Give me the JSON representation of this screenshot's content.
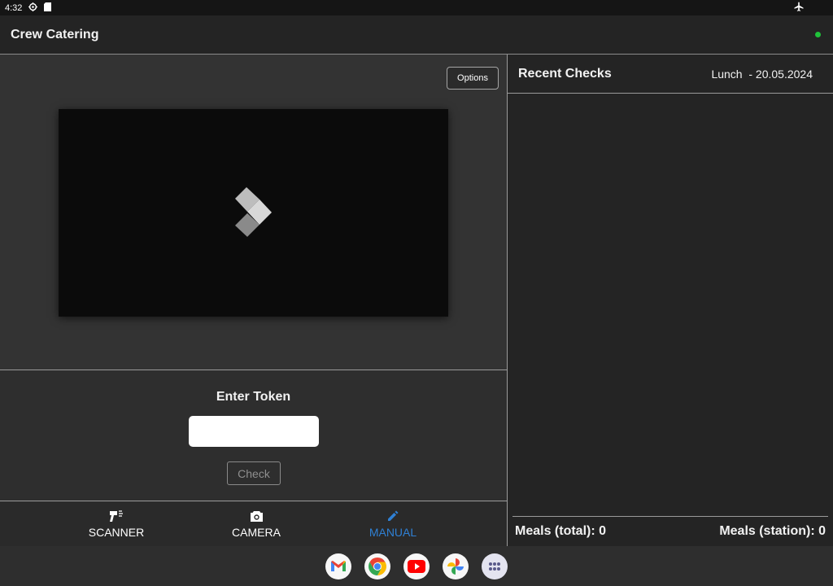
{
  "status_bar": {
    "time": "4:32"
  },
  "app": {
    "title": "Crew Catering",
    "status_color": "#1fc23a"
  },
  "camera": {
    "options_label": "Options"
  },
  "token": {
    "title": "Enter Token",
    "input_value": "",
    "check_label": "Check"
  },
  "nav": {
    "items": [
      {
        "label": "SCANNER",
        "icon": "barcode-scanner-icon",
        "active": false
      },
      {
        "label": "CAMERA",
        "icon": "camera-icon",
        "active": false
      },
      {
        "label": "MANUAL",
        "icon": "pencil-icon",
        "active": true
      }
    ],
    "active_color": "#2f80d4"
  },
  "recent": {
    "title": "Recent Checks",
    "meal": "Lunch  - 20.05.2024",
    "meals_total": "Meals (total): 0",
    "meals_station": "Meals (station): 0"
  },
  "taskbar": {
    "apps": [
      "gmail-icon",
      "chrome-icon",
      "youtube-icon",
      "photos-icon",
      "app-launcher-icon"
    ]
  }
}
